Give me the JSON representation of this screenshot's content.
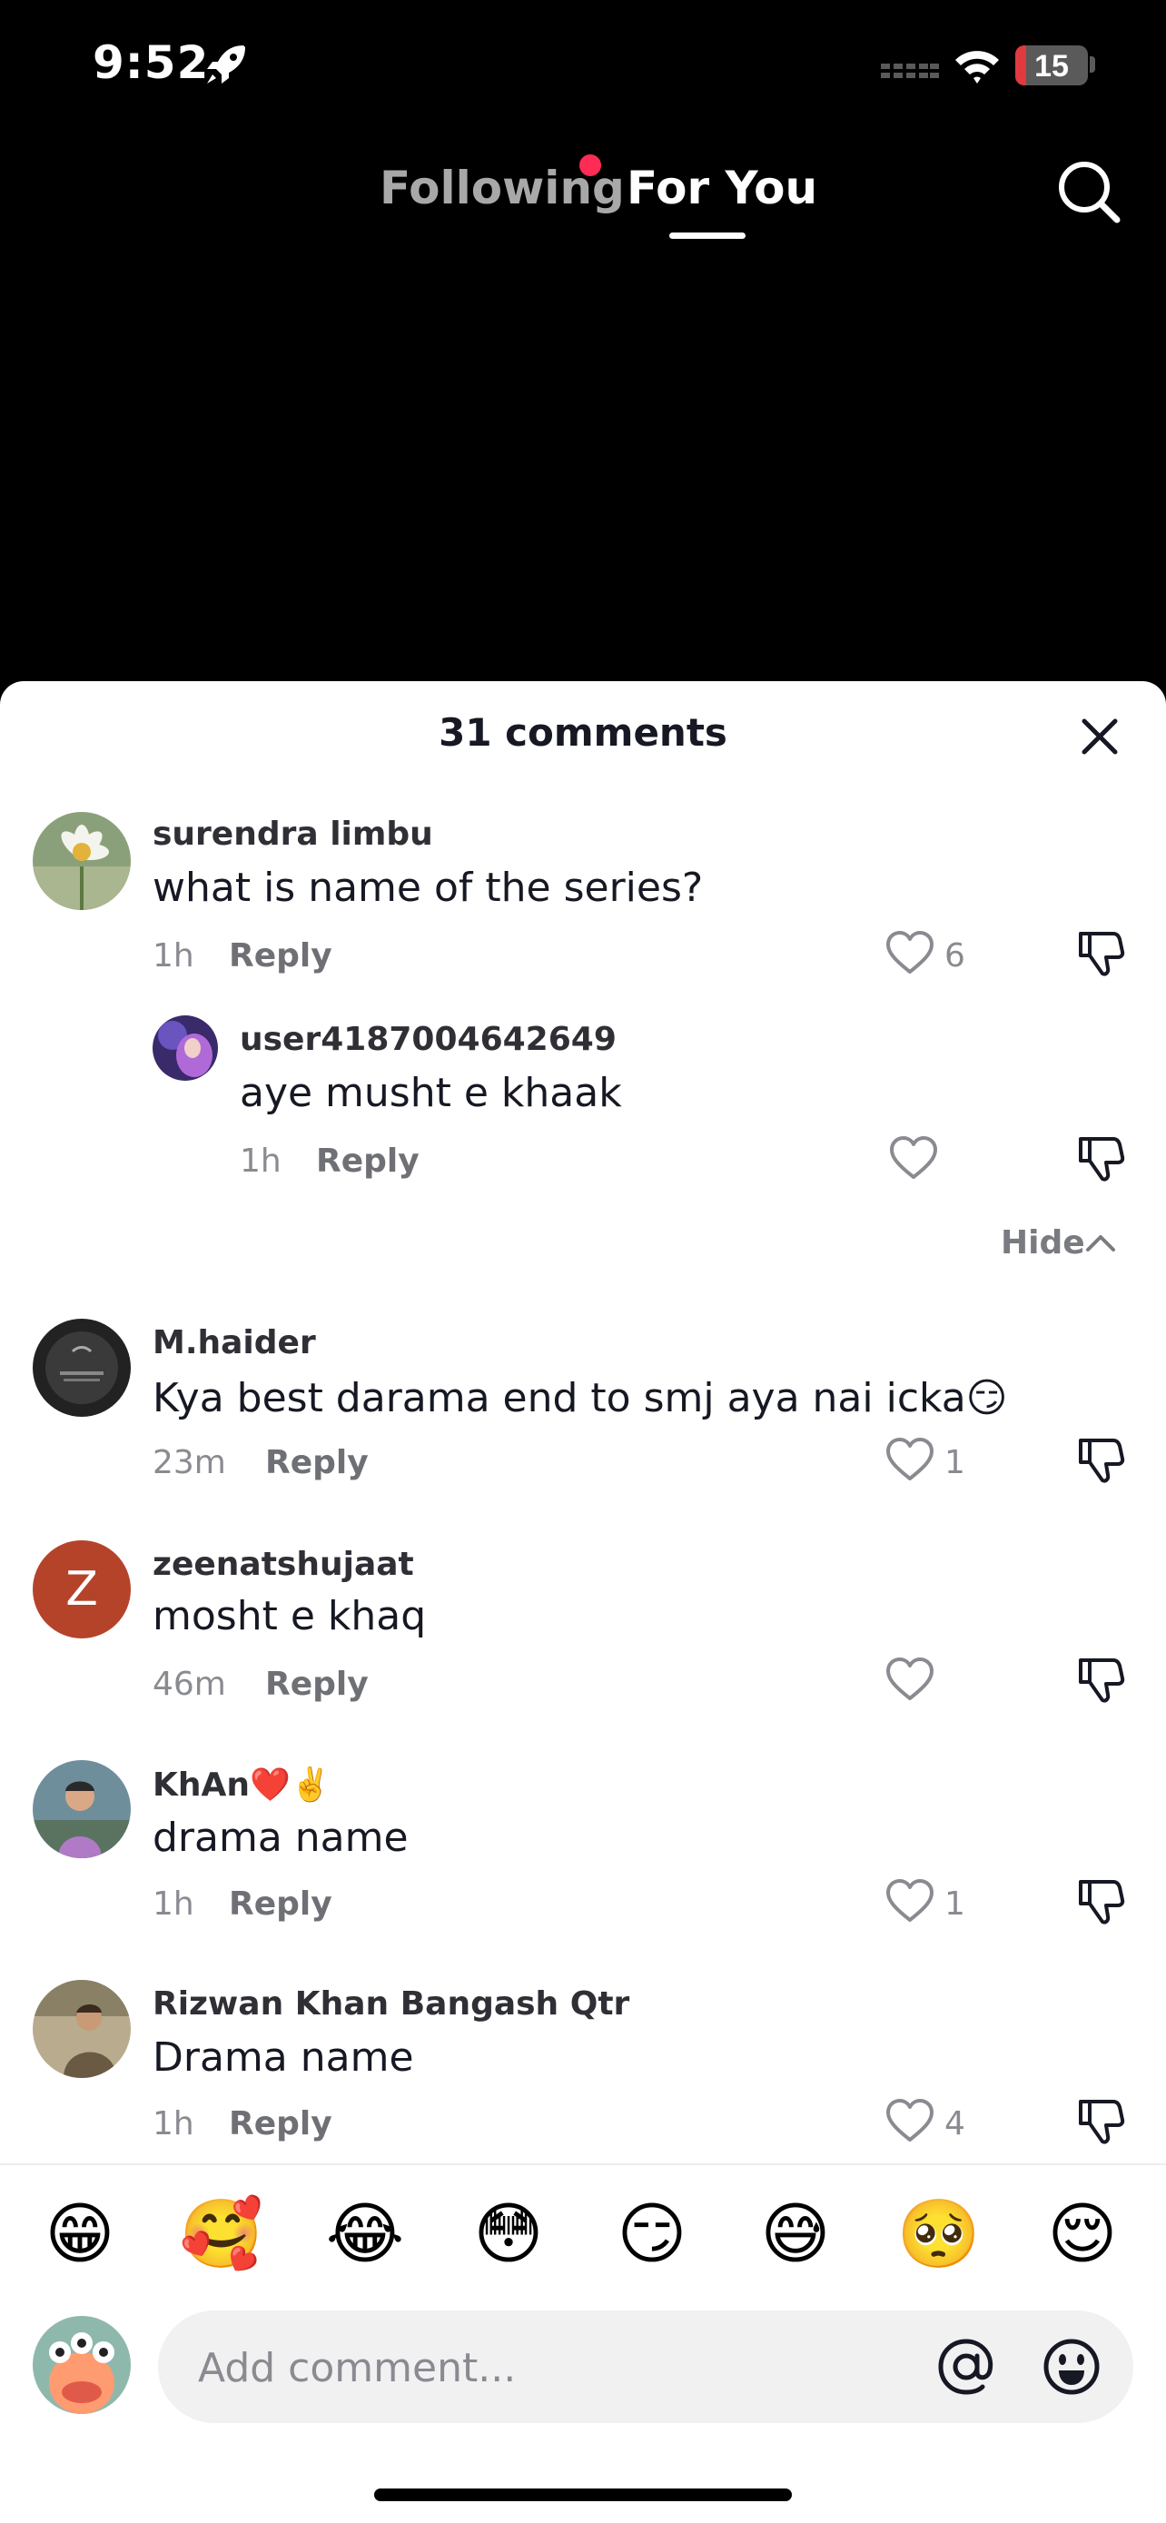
{
  "status_bar": {
    "time": "9:52",
    "battery": "15",
    "battery_level": 0.15
  },
  "nav": {
    "following": "Following",
    "for_you": "For You"
  },
  "comments_sheet": {
    "title": "31 comments",
    "hide_label": "Hide",
    "comments": [
      {
        "username": "surendra limbu",
        "text": "what is name of the series?",
        "time": "1h",
        "reply": "Reply",
        "likes": "6"
      },
      {
        "username": "user4187004642649",
        "text": "aye musht e khaak",
        "time": "1h",
        "reply": "Reply",
        "likes": ""
      },
      {
        "username": "M.haider",
        "text": "Kya best darama end to smj aya nai icka😏",
        "time": "23m",
        "reply": "Reply",
        "likes": "1"
      },
      {
        "username": "zeenatshujaat",
        "text": "mosht e khaq",
        "time": "46m",
        "reply": "Reply",
        "likes": "",
        "avatar_letter": "Z"
      },
      {
        "username": "KhAn❤️✌️",
        "text": "drama name",
        "time": "1h",
        "reply": "Reply",
        "likes": "1"
      },
      {
        "username": "Rizwan Khan Bangash Qtr",
        "text": "Drama name",
        "time": "1h",
        "reply": "Reply",
        "likes": "4"
      }
    ]
  },
  "emoji_bar": [
    "😁",
    "🥰",
    "😂",
    "😳",
    "😏",
    "😅",
    "🥺",
    "😌"
  ],
  "composer": {
    "placeholder": "Add comment..."
  },
  "colors": {
    "accent": "#fe2c55",
    "sheet_bg": "#ffffff",
    "input_bg": "#f1f1f2",
    "z_avatar": "#b5432a"
  }
}
